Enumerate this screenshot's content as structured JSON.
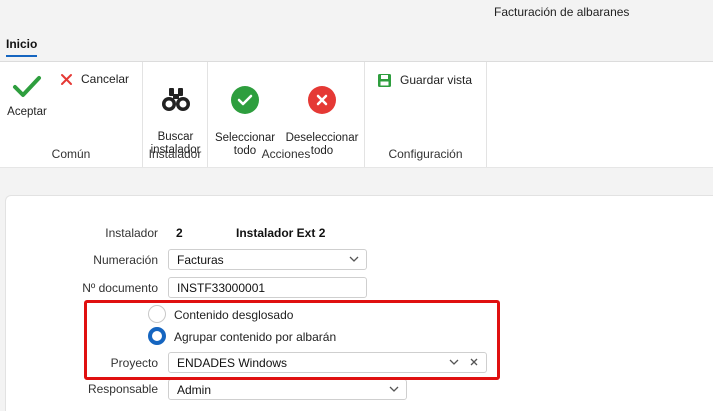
{
  "window": {
    "title": "Facturación de albaranes"
  },
  "tabs": [
    {
      "label": "Inicio"
    }
  ],
  "ribbon": {
    "comun": {
      "label": "Común",
      "aceptar": "Aceptar",
      "cancelar": "Cancelar"
    },
    "instalador": {
      "label": "Instalador",
      "buscar": "Buscar\ninstalador"
    },
    "acciones": {
      "label": "Acciones",
      "seleccionar": "Seleccionar\ntodo",
      "deseleccionar": "Deseleccionar\ntodo"
    },
    "configuracion": {
      "label": "Configuración",
      "guardar": "Guardar vista"
    }
  },
  "form": {
    "instalador": {
      "label": "Instalador",
      "code": "2",
      "name": "Instalador Ext 2"
    },
    "numeracion": {
      "label": "Numeración",
      "value": "Facturas"
    },
    "documento": {
      "label": "Nº documento",
      "value": "INSTF33000001"
    },
    "radio_desglosado": {
      "label": "Contenido desglosado",
      "checked": false
    },
    "radio_agrupar": {
      "label": "Agrupar contenido por albarán",
      "checked": true
    },
    "proyecto": {
      "label": "Proyecto",
      "value": "ENDADES Windows"
    },
    "responsable": {
      "label": "Responsable",
      "value": "Admin"
    }
  },
  "colors": {
    "accent": "#1565c0",
    "ok": "#2e9e3e",
    "cancel": "#e53935",
    "highlight": "#e01010"
  }
}
